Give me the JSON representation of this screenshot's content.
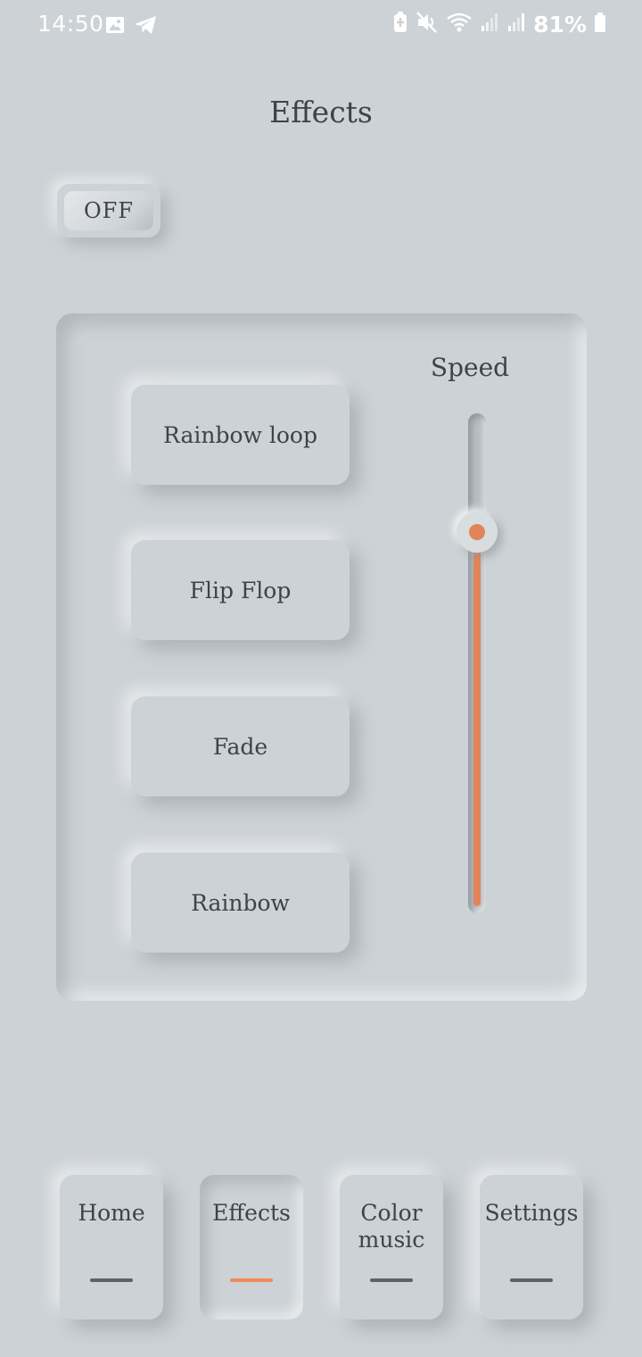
{
  "status_bar": {
    "time": "14:50",
    "left_icons": [
      "image-icon",
      "telegram-icon"
    ],
    "right_icons": [
      "battery-saver-icon",
      "mute-icon",
      "wifi-icon",
      "signal-icon",
      "signal-icon-2"
    ],
    "battery": "81%"
  },
  "page": {
    "title": "Effects"
  },
  "power": {
    "label": "OFF"
  },
  "effects": [
    {
      "label": "Rainbow loop"
    },
    {
      "label": "Flip Flop"
    },
    {
      "label": "Fade"
    },
    {
      "label": "Rainbow"
    }
  ],
  "speed": {
    "label": "Speed",
    "value": 0.77
  },
  "nav": {
    "tabs": [
      {
        "label": "Home",
        "active": false
      },
      {
        "label": "Effects",
        "active": true
      },
      {
        "label": "Color music",
        "active": false
      },
      {
        "label": "Settings",
        "active": false
      }
    ]
  },
  "colors": {
    "background": "#cdd2d6",
    "accent": "#e2845a",
    "text": "#3e4347",
    "inactive_indicator": "#5d6266"
  }
}
